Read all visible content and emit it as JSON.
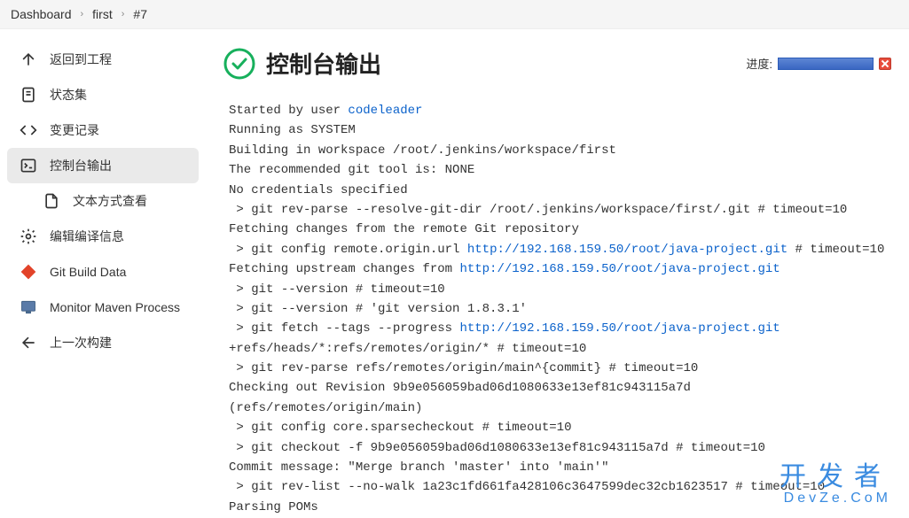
{
  "breadcrumb": {
    "a": "Dashboard",
    "b": "first",
    "c": "#7"
  },
  "sidebar": {
    "items": [
      {
        "label": "返回到工程"
      },
      {
        "label": "状态集"
      },
      {
        "label": "变更记录"
      },
      {
        "label": "控制台输出"
      },
      {
        "label": "文本方式查看"
      },
      {
        "label": "编辑编译信息"
      },
      {
        "label": "Git Build Data"
      },
      {
        "label": "Monitor Maven Process"
      },
      {
        "label": "上一次构建"
      }
    ]
  },
  "page": {
    "title": "控制台输出",
    "progress_label": "进度:"
  },
  "console": {
    "l0a": "Started by user ",
    "l0b": "codeleader",
    "l1": "Running as SYSTEM",
    "l2": "Building in workspace /root/.jenkins/workspace/first",
    "l3": "The recommended git tool is: NONE",
    "l4": "No credentials specified",
    "l5": " > git rev-parse --resolve-git-dir /root/.jenkins/workspace/first/.git # timeout=10",
    "l6": "Fetching changes from the remote Git repository",
    "l7a": " > git config remote.origin.url ",
    "l7b": "http://192.168.159.50/root/java-project.git",
    "l7c": " # timeout=10",
    "l8a": "Fetching upstream changes from ",
    "l8b": "http://192.168.159.50/root/java-project.git",
    "l9": " > git --version # timeout=10",
    "l10": " > git --version # 'git version 1.8.3.1'",
    "l11a": " > git fetch --tags --progress ",
    "l11b": "http://192.168.159.50/root/java-project.git",
    "l12": "+refs/heads/*:refs/remotes/origin/* # timeout=10",
    "l13": " > git rev-parse refs/remotes/origin/main^{commit} # timeout=10",
    "l14": "Checking out Revision 9b9e056059bad06d1080633e13ef81c943115a7d (refs/remotes/origin/main)",
    "l15": " > git config core.sparsecheckout # timeout=10",
    "l16": " > git checkout -f 9b9e056059bad06d1080633e13ef81c943115a7d # timeout=10",
    "l17": "Commit message: \"Merge branch 'master' into 'main'\"",
    "l18": " > git rev-list --no-walk 1a23c1fd661fa428106c3647599dec32cb1623517 # timeout=10",
    "l19": "Parsing POMs"
  },
  "watermark": {
    "big": "开发者",
    "small": "DevZe.CoM"
  }
}
